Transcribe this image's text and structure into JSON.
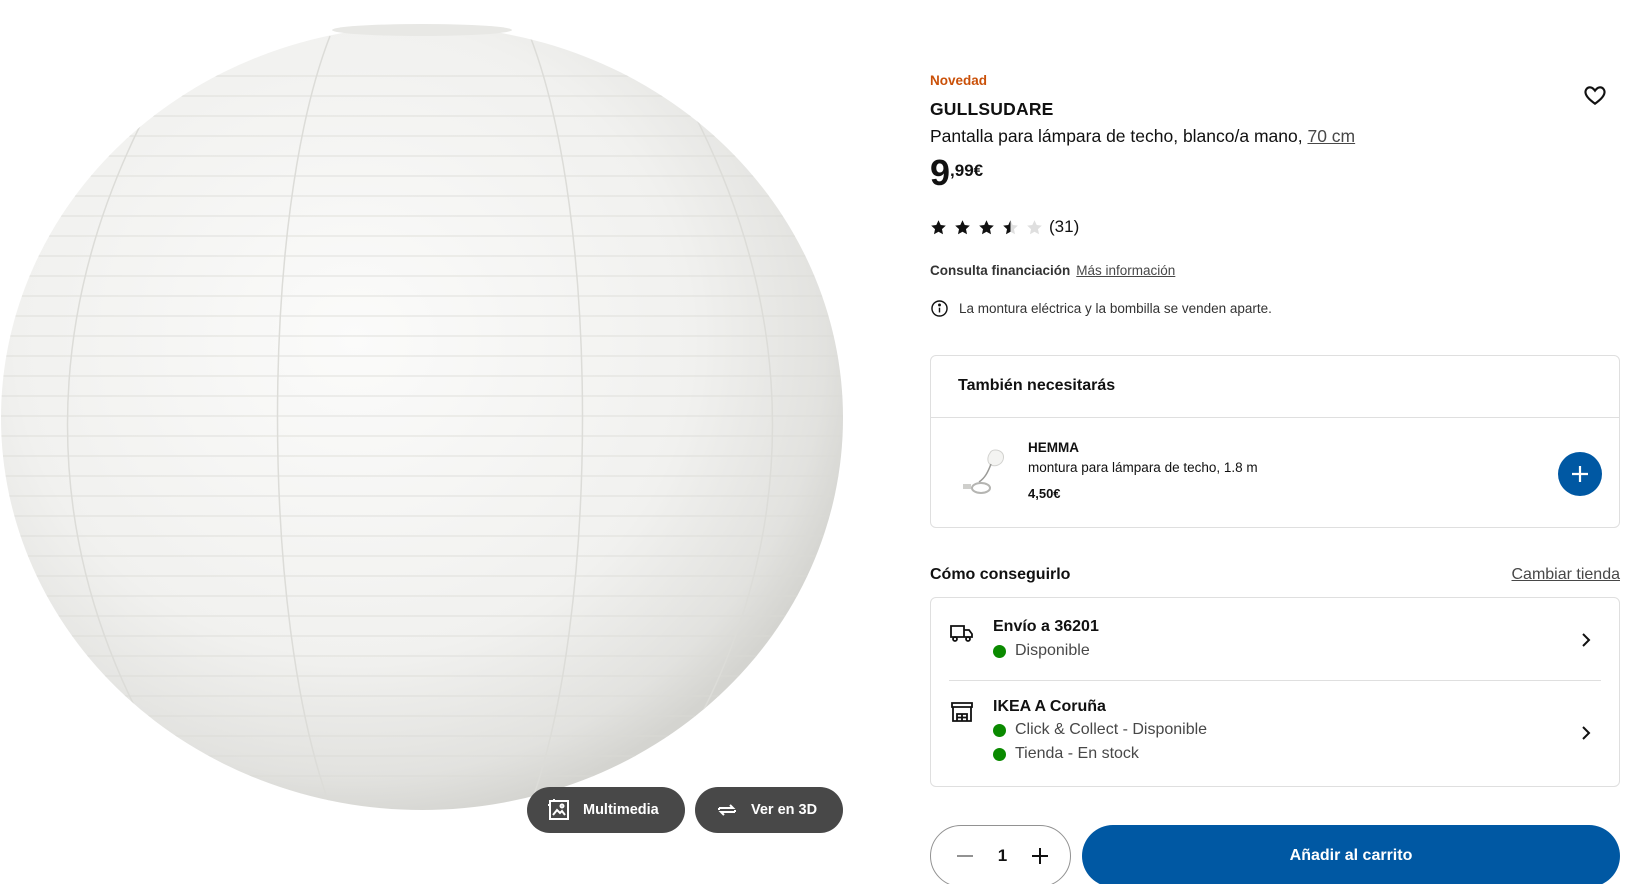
{
  "media": {
    "multimedia_label": "Multimedia",
    "view3d_label": "Ver en 3D"
  },
  "product": {
    "badge": "Novedad",
    "name": "GULLSUDARE",
    "description": "Pantalla para lámpara de techo, blanco/a mano, ",
    "size_link": "70 cm",
    "price_integer": "9",
    "price_decimal": ",99€",
    "rating_value": 3.5,
    "rating_max": 5,
    "review_count": "(31)",
    "financing_label": "Consulta financiación",
    "financing_link": "Más información",
    "notice": "La montura eléctrica y la bombilla se venden aparte."
  },
  "accessory": {
    "section_title": "También necesitarás",
    "name": "HEMMA",
    "description": "montura para lámpara de techo, 1.8 m",
    "price": "4,50€"
  },
  "availability": {
    "title": "Cómo conseguirlo",
    "change_store": "Cambiar tienda",
    "delivery": {
      "title": "Envío a 36201",
      "status": "Disponible"
    },
    "store": {
      "title": "IKEA A Coruña",
      "status1": "Click & Collect - Disponible",
      "status2": "Tienda - En stock"
    }
  },
  "purchase": {
    "quantity": "1",
    "add_to_cart": "Añadir al carrito"
  },
  "colors": {
    "brand_blue": "#0058a3",
    "badge_orange": "#ca5008",
    "available_green": "#0a8a00",
    "media_button_bg": "#484848"
  },
  "icons": [
    "heart-icon",
    "star-icon",
    "info-icon",
    "plus-icon",
    "truck-icon",
    "store-icon",
    "chevron-right-icon",
    "minus-icon",
    "image-icon",
    "rotate-3d-icon"
  ]
}
